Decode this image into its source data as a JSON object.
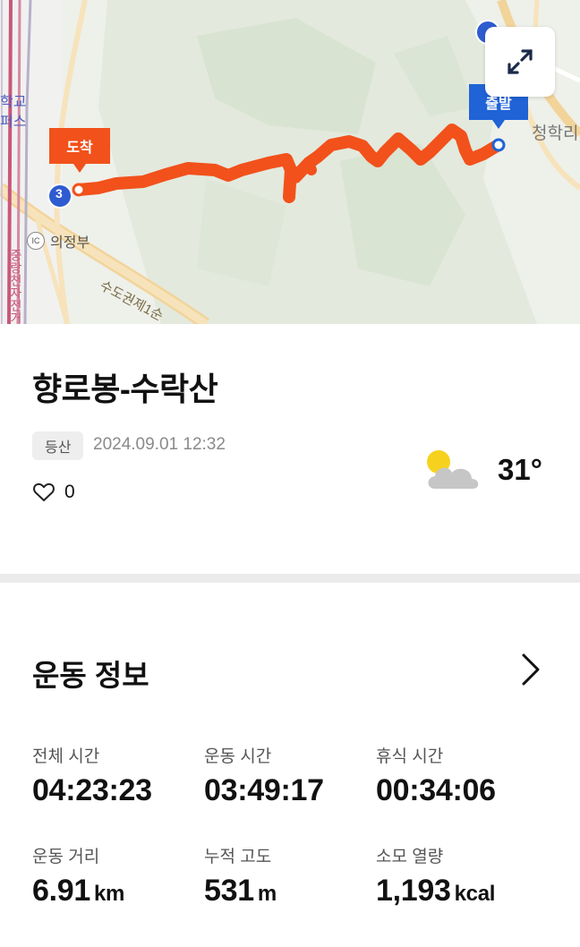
{
  "map": {
    "labels": {
      "interchange": "의정부",
      "interchange_badge": "IC",
      "place_right": "청학리",
      "school_partial_1": "학교",
      "school_partial_2": "퍼스",
      "road_diag": "수도권제1순",
      "road_vertical": "중랑천자전거"
    },
    "route_badge": "3",
    "end_marker": "도착",
    "start_marker": "출발",
    "route_color": "#f2511b",
    "start_color": "#1f63d6"
  },
  "activity": {
    "title": "향로봉-수락산",
    "tag": "등산",
    "datetime": "2024.09.01 12:32",
    "likes": "0",
    "temperature": "31°"
  },
  "exercise": {
    "section_title": "운동 정보",
    "stats": [
      {
        "label": "전체 시간",
        "value": "04:23:23",
        "unit": ""
      },
      {
        "label": "운동 시간",
        "value": "03:49:17",
        "unit": ""
      },
      {
        "label": "휴식 시간",
        "value": "00:34:06",
        "unit": ""
      },
      {
        "label": "운동 거리",
        "value": "6.91",
        "unit": "km"
      },
      {
        "label": "누적 고도",
        "value": "531",
        "unit": "m"
      },
      {
        "label": "소모 열량",
        "value": "1,193",
        "unit": "kcal"
      }
    ]
  },
  "icons": {
    "expand": "expand-icon",
    "heart": "heart-icon",
    "weather": "partly-cloudy-icon",
    "chevron": "chevron-right-icon"
  }
}
